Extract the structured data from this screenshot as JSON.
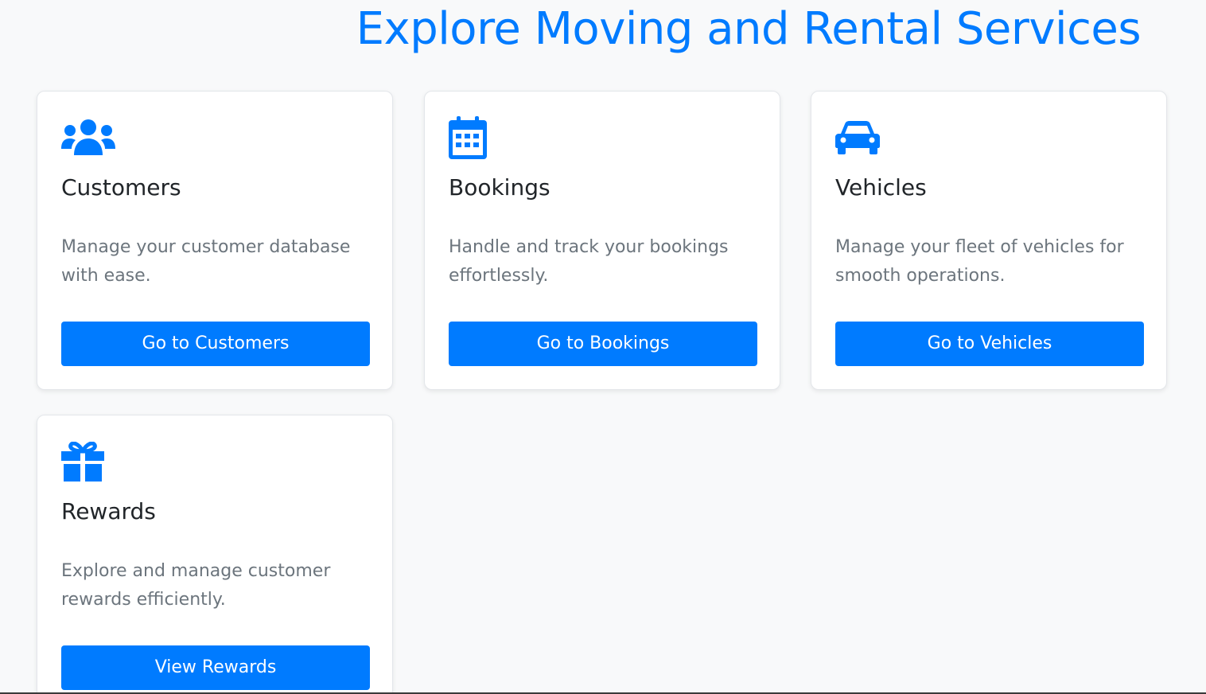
{
  "page": {
    "title": "Explore Moving and Rental Services"
  },
  "colors": {
    "accent": "#007bff",
    "background": "#f8f9fa",
    "title_text": "#212529",
    "desc_text": "#6c757d"
  },
  "cards": [
    {
      "icon": "users-icon",
      "title": "Customers",
      "description": "Manage your customer database with ease.",
      "button_label": "Go to Customers"
    },
    {
      "icon": "calendar-icon",
      "title": "Bookings",
      "description": "Handle and track your bookings effortlessly.",
      "button_label": "Go to Bookings"
    },
    {
      "icon": "car-icon",
      "title": "Vehicles",
      "description": "Manage your fleet of vehicles for smooth operations.",
      "button_label": "Go to Vehicles"
    },
    {
      "icon": "gift-icon",
      "title": "Rewards",
      "description": "Explore and manage customer rewards efficiently.",
      "button_label": "View Rewards"
    }
  ]
}
